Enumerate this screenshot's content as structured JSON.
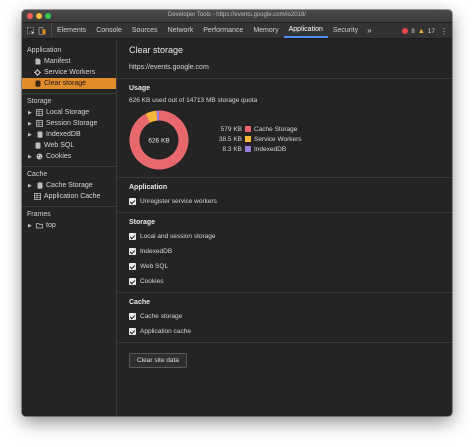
{
  "window": {
    "title": "Developer Tools - https://events.google.com/io2018/"
  },
  "tabs": [
    {
      "label": "Elements"
    },
    {
      "label": "Console"
    },
    {
      "label": "Sources"
    },
    {
      "label": "Network"
    },
    {
      "label": "Performance"
    },
    {
      "label": "Memory"
    },
    {
      "label": "Application"
    },
    {
      "label": "Security"
    }
  ],
  "toolbar": {
    "more": "»",
    "errors": "8",
    "warnings": "17",
    "menu": "⋮"
  },
  "sidebar": {
    "application": {
      "title": "Application",
      "items": [
        "Manifest",
        "Service Workers",
        "Clear storage"
      ]
    },
    "storage": {
      "title": "Storage",
      "items": [
        "Local Storage",
        "Session Storage",
        "IndexedDB",
        "Web SQL",
        "Cookies"
      ]
    },
    "cache": {
      "title": "Cache",
      "items": [
        "Cache Storage",
        "Application Cache"
      ]
    },
    "frames": {
      "title": "Frames",
      "items": [
        "top"
      ]
    }
  },
  "main": {
    "title": "Clear storage",
    "origin": "https://events.google.com",
    "usage": {
      "heading": "Usage",
      "quota_text": "626 KB used out of 14713 MB storage quota",
      "total_label": "626 KB",
      "legend": [
        {
          "value": "579 KB",
          "label": "Cache Storage",
          "color": "#e8696d",
          "kb": 579
        },
        {
          "value": "38.5 KB",
          "label": "Service Workers",
          "color": "#f6b73c",
          "kb": 38.5
        },
        {
          "value": "8.3 KB",
          "label": "IndexedDB",
          "color": "#9a7be0",
          "kb": 8.3
        }
      ]
    },
    "application": {
      "heading": "Application",
      "options": [
        "Unregister service workers"
      ]
    },
    "storage": {
      "heading": "Storage",
      "options": [
        "Local and session storage",
        "IndexedDB",
        "Web SQL",
        "Cookies"
      ]
    },
    "cache": {
      "heading": "Cache",
      "options": [
        "Cache storage",
        "Application cache"
      ]
    },
    "clear_button": "Clear site data"
  }
}
